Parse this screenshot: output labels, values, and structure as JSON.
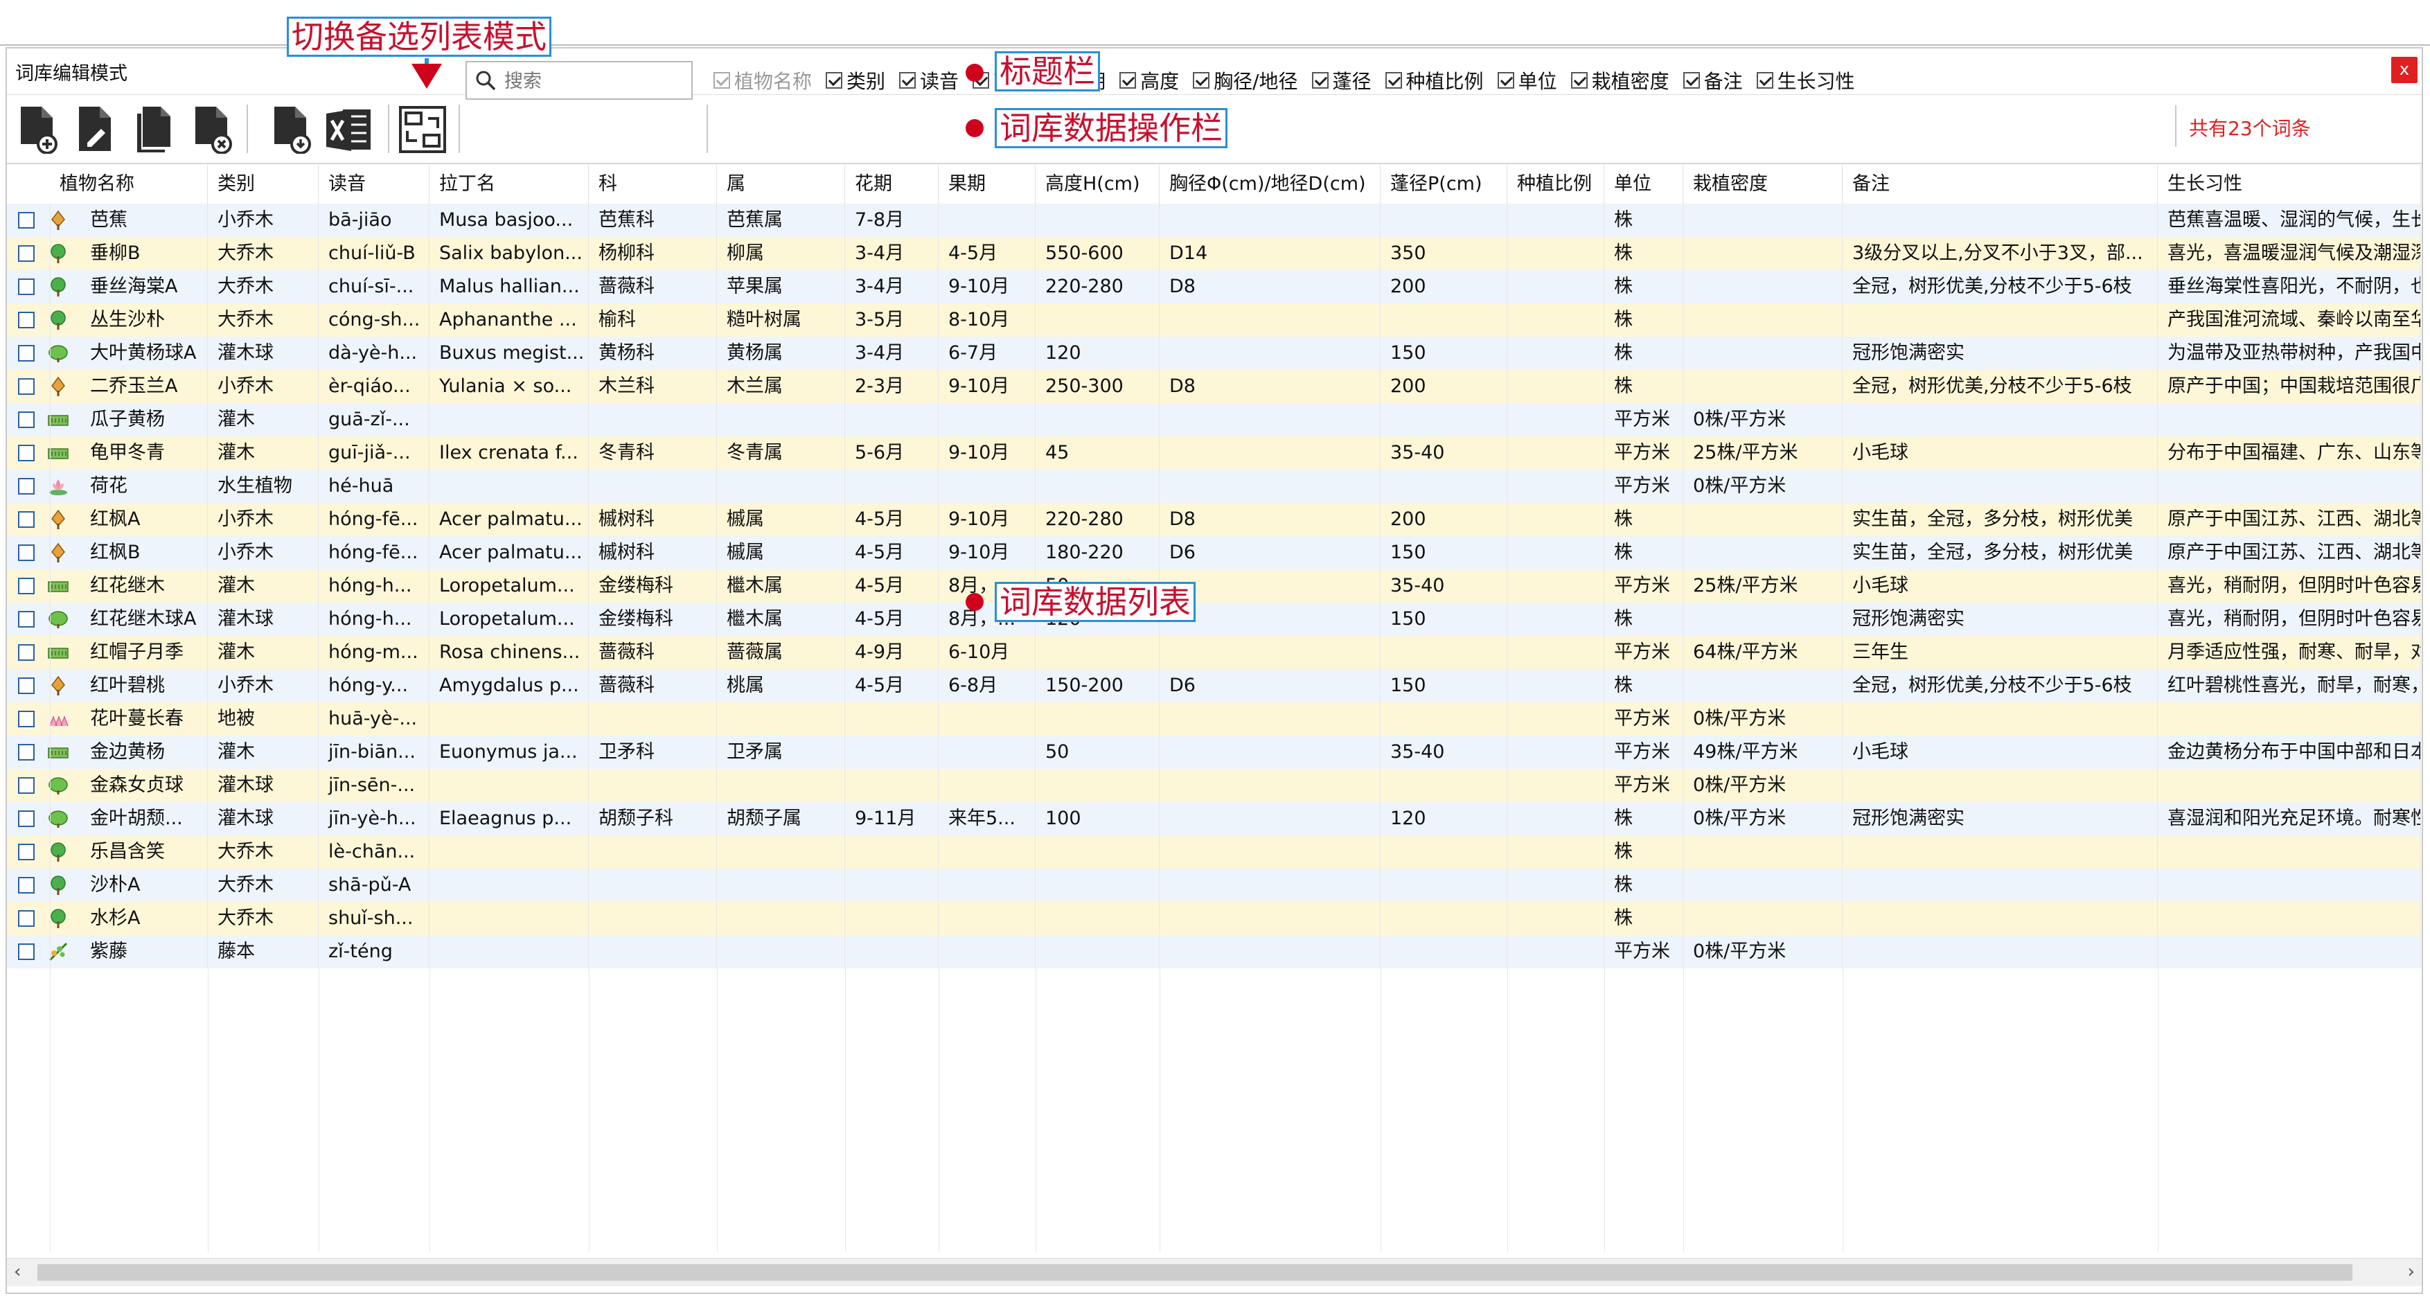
{
  "window": {
    "title": "词库编辑模式",
    "close_label": "x"
  },
  "toolbar": {
    "buttons": [
      {
        "name": "add-entry-button",
        "icon": "file-add-icon"
      },
      {
        "name": "edit-entry-button",
        "icon": "file-edit-icon"
      },
      {
        "name": "copy-entry-button",
        "icon": "file-copy-icon"
      },
      {
        "name": "delete-entry-button",
        "icon": "file-delete-icon"
      },
      {
        "name": "import-button",
        "icon": "file-import-icon"
      },
      {
        "name": "excel-export-button",
        "icon": "excel-icon"
      },
      {
        "name": "switch-list-mode-button",
        "icon": "switch-mode-icon"
      }
    ],
    "search_placeholder": "搜索",
    "column_toggles": [
      {
        "label": "植物名称",
        "checked": true,
        "disabled": true
      },
      {
        "label": "类别",
        "checked": true
      },
      {
        "label": "读音",
        "checked": true
      },
      {
        "label": "花期",
        "checked": true
      },
      {
        "label": "果期",
        "checked": true
      },
      {
        "label": "高度",
        "checked": true
      },
      {
        "label": "胸径/地径",
        "checked": true
      },
      {
        "label": "蓬径",
        "checked": true
      },
      {
        "label": "种植比例",
        "checked": true
      },
      {
        "label": "单位",
        "checked": true
      },
      {
        "label": "栽植密度",
        "checked": true
      },
      {
        "label": "备注",
        "checked": true
      },
      {
        "label": "生长习性",
        "checked": true
      }
    ],
    "count_text": "共有23个词条"
  },
  "table": {
    "headers": [
      "植物名称",
      "类别",
      "读音",
      "拉丁名",
      "科",
      "属",
      "花期",
      "果期",
      "高度H(cm)",
      "胸径Φ(cm)/地径D(cm)",
      "蓬径P(cm)",
      "种植比例",
      "单位",
      "栽植密度",
      "备注",
      "生长习性"
    ],
    "rows": [
      {
        "icon": "broadleaf-tree-icon",
        "c": [
          "芭蕉",
          "小乔木",
          "bā-jiāo",
          "Musa basjoo...",
          "芭蕉科",
          "芭蕉属",
          "7-8月",
          "",
          "",
          "",
          "",
          "",
          "株",
          "",
          "",
          "芭蕉喜温暖、湿润的气候，生长"
        ]
      },
      {
        "icon": "round-tree-icon",
        "c": [
          "垂柳B",
          "大乔木",
          "chuí-liǔ-B",
          "Salix babylon...",
          "杨柳科",
          "柳属",
          "3-4月",
          "4-5月",
          "550-600",
          "D14",
          "350",
          "",
          "株",
          "",
          "3级分叉以上,分叉不小于3叉，部...",
          "喜光，喜温暖湿润气候及潮湿深"
        ]
      },
      {
        "icon": "round-tree-icon",
        "c": [
          "垂丝海棠A",
          "大乔木",
          "chuí-sī-...",
          "Malus hallian...",
          "蔷薇科",
          "苹果属",
          "3-4月",
          "9-10月",
          "220-280",
          "D8",
          "200",
          "",
          "株",
          "",
          "全冠，树形优美,分枝不少于5-6枝",
          "垂丝海棠性喜阳光，不耐阴，也"
        ]
      },
      {
        "icon": "round-tree-icon",
        "c": [
          "丛生沙朴",
          "大乔木",
          "cóng-sh...",
          "Aphananthe ...",
          "榆科",
          "糙叶树属",
          "3-5月",
          "8-10月",
          "",
          "",
          "",
          "",
          "株",
          "",
          "",
          "产我国淮河流域、秦岭以南至华"
        ]
      },
      {
        "icon": "shrub-ball-icon",
        "c": [
          "大叶黄杨球A",
          "灌木球",
          "dà-yè-h...",
          "Buxus megist...",
          "黄杨科",
          "黄杨属",
          "3-4月",
          "6-7月",
          "120",
          "",
          "150",
          "",
          "株",
          "",
          "冠形饱满密实",
          "为温带及亚热带树种，产我国中"
        ]
      },
      {
        "icon": "broadleaf-tree-icon",
        "c": [
          "二乔玉兰A",
          "小乔木",
          "èr-qiáo...",
          "Yulania × so...",
          "木兰科",
          "木兰属",
          "2-3月",
          "9-10月",
          "250-300",
          "D8",
          "200",
          "",
          "株",
          "",
          "全冠，树形优美,分枝不少于5-6枝",
          "原产于中国；中国栽培范围很广"
        ]
      },
      {
        "icon": "hedge-icon",
        "c": [
          "瓜子黄杨",
          "灌木",
          "guā-zǐ-...",
          "",
          "",
          "",
          "",
          "",
          "",
          "",
          "",
          "",
          "平方米",
          "0株/平方米",
          "",
          ""
        ]
      },
      {
        "icon": "hedge-icon",
        "c": [
          "龟甲冬青",
          "灌木",
          "guī-jiǎ-...",
          "Ilex crenata f...",
          "冬青科",
          "冬青属",
          "5-6月",
          "9-10月",
          "45",
          "",
          "35-40",
          "",
          "平方米",
          "25株/平方米",
          "小毛球",
          "分布于中国福建、广东、山东等"
        ]
      },
      {
        "icon": "lotus-icon",
        "c": [
          "荷花",
          "水生植物",
          "hé-huā",
          "",
          "",
          "",
          "",
          "",
          "",
          "",
          "",
          "",
          "平方米",
          "0株/平方米",
          "",
          ""
        ]
      },
      {
        "icon": "broadleaf-tree-icon",
        "c": [
          "红枫A",
          "小乔木",
          "hóng-fē...",
          "Acer palmatu...",
          "槭树科",
          "槭属",
          "4-5月",
          "9-10月",
          "220-280",
          "D8",
          "200",
          "",
          "株",
          "",
          "实生苗，全冠，多分枝，树形优美",
          "原产于中国江苏、江西、湖北等"
        ]
      },
      {
        "icon": "broadleaf-tree-icon",
        "c": [
          "红枫B",
          "小乔木",
          "hóng-fē...",
          "Acer palmatu...",
          "槭树科",
          "槭属",
          "4-5月",
          "9-10月",
          "180-220",
          "D6",
          "150",
          "",
          "株",
          "",
          "实生苗，全冠，多分枝，树形优美",
          "原产于中国江苏、江西、湖北等"
        ]
      },
      {
        "icon": "hedge-icon",
        "c": [
          "红花继木",
          "灌木",
          "hóng-h...",
          "Loropetalum...",
          "金缕梅科",
          "檵木属",
          "4-5月",
          "8月，...",
          "50",
          "",
          "35-40",
          "",
          "平方米",
          "25株/平方米",
          "小毛球",
          "喜光，稍耐阴，但阴时叶色容易"
        ]
      },
      {
        "icon": "shrub-ball-icon",
        "c": [
          "红花继木球A",
          "灌木球",
          "hóng-h...",
          "Loropetalum...",
          "金缕梅科",
          "檵木属",
          "4-5月",
          "8月，...",
          "120",
          "",
          "150",
          "",
          "株",
          "",
          "冠形饱满密实",
          "喜光，稍耐阴，但阴时叶色容易"
        ]
      },
      {
        "icon": "hedge-icon",
        "c": [
          "红帽子月季",
          "灌木",
          "hóng-m...",
          "Rosa chinens...",
          "蔷薇科",
          "蔷薇属",
          "4-9月",
          "6-10月",
          "",
          "",
          "",
          "",
          "平方米",
          "64株/平方米",
          "三年生",
          "月季适应性强，耐寒、耐旱，对"
        ]
      },
      {
        "icon": "broadleaf-tree-icon",
        "c": [
          "红叶碧桃",
          "小乔木",
          "hóng-y...",
          "Amygdalus p...",
          "蔷薇科",
          "桃属",
          "4-5月",
          "6-8月",
          "150-200",
          "D6",
          "150",
          "",
          "株",
          "",
          "全冠，树形优美,分枝不少于5-6枝",
          "红叶碧桃性喜光，耐旱，耐寒，"
        ]
      },
      {
        "icon": "groundcover-icon",
        "c": [
          "花叶蔓长春",
          "地被",
          "huā-yè-...",
          "",
          "",
          "",
          "",
          "",
          "",
          "",
          "",
          "",
          "平方米",
          "0株/平方米",
          "",
          ""
        ]
      },
      {
        "icon": "hedge-icon",
        "c": [
          "金边黄杨",
          "灌木",
          "jīn-biān...",
          "Euonymus ja...",
          "卫矛科",
          "卫矛属",
          "",
          "",
          "50",
          "",
          "35-40",
          "",
          "平方米",
          "49株/平方米",
          "小毛球",
          "金边黄杨分布于中国中部和日本"
        ]
      },
      {
        "icon": "shrub-ball-icon",
        "c": [
          "金森女贞球",
          "灌木球",
          "jīn-sēn-...",
          "",
          "",
          "",
          "",
          "",
          "",
          "",
          "",
          "",
          "平方米",
          "0株/平方米",
          "",
          ""
        ]
      },
      {
        "icon": "shrub-ball-icon",
        "c": [
          "金叶胡颓...",
          "灌木球",
          "jīn-yè-h...",
          "Elaeagnus p...",
          "胡颓子科",
          "胡颓子属",
          "9-11月",
          "来年5...",
          "100",
          "",
          "120",
          "",
          "株",
          "0株/平方米",
          "冠形饱满密实",
          "喜湿润和阳光充足环境。耐寒性"
        ]
      },
      {
        "icon": "round-tree-icon",
        "c": [
          "乐昌含笑",
          "大乔木",
          "lè-chān...",
          "",
          "",
          "",
          "",
          "",
          "",
          "",
          "",
          "",
          "株",
          "",
          "",
          ""
        ]
      },
      {
        "icon": "round-tree-icon",
        "c": [
          "沙朴A",
          "大乔木",
          "shā-pǔ-A",
          "",
          "",
          "",
          "",
          "",
          "",
          "",
          "",
          "",
          "株",
          "",
          "",
          ""
        ]
      },
      {
        "icon": "round-tree-icon",
        "c": [
          "水杉A",
          "大乔木",
          "shuǐ-sh...",
          "",
          "",
          "",
          "",
          "",
          "",
          "",
          "",
          "",
          "株",
          "",
          "",
          ""
        ]
      },
      {
        "icon": "vine-icon",
        "c": [
          "紫藤",
          "藤本",
          "zǐ-téng",
          "",
          "",
          "",
          "",
          "",
          "",
          "",
          "",
          "",
          "平方米",
          "0株/平方米",
          "",
          ""
        ]
      }
    ]
  },
  "annotations": {
    "switch_mode": "切换备选列表模式",
    "title_bar": "标题栏",
    "operation_bar": "词库数据操作栏",
    "data_list": "词库数据列表"
  },
  "colors": {
    "accent_red": "#d0021b",
    "callout_border": "#2a8fd8",
    "row_odd": "#eef4fb",
    "row_even": "#fdf7d8"
  }
}
